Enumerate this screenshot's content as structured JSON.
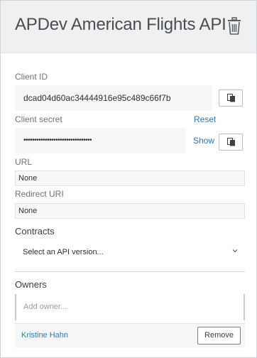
{
  "header": {
    "title": "APDev American Flights API",
    "delete_icon": "trash-icon"
  },
  "client_id": {
    "label": "Client ID",
    "value": "dcad04d60ac34444916e95c489c66f7b",
    "copy_icon": "clipboard-icon"
  },
  "client_secret": {
    "label": "Client secret",
    "reset_label": "Reset",
    "value": "••••••••••••••••••••••••••••••••",
    "show_label": "Show",
    "copy_icon": "clipboard-icon"
  },
  "url": {
    "label": "URL",
    "value": "None"
  },
  "redirect_uri": {
    "label": "Redirect URI",
    "value": "None"
  },
  "contracts": {
    "label": "Contracts",
    "select_placeholder": "Select an API version...",
    "chevron_icon": "chevron-down-icon"
  },
  "owners": {
    "label": "Owners",
    "input_placeholder": "Add owner...",
    "list": [
      {
        "name": "Kristine Hahn",
        "remove_label": "Remove"
      }
    ]
  },
  "colors": {
    "link": "#2b7bb9",
    "header_bg": "#eef0f1",
    "field_bg": "#f5f6f7",
    "text": "#3f4247"
  }
}
